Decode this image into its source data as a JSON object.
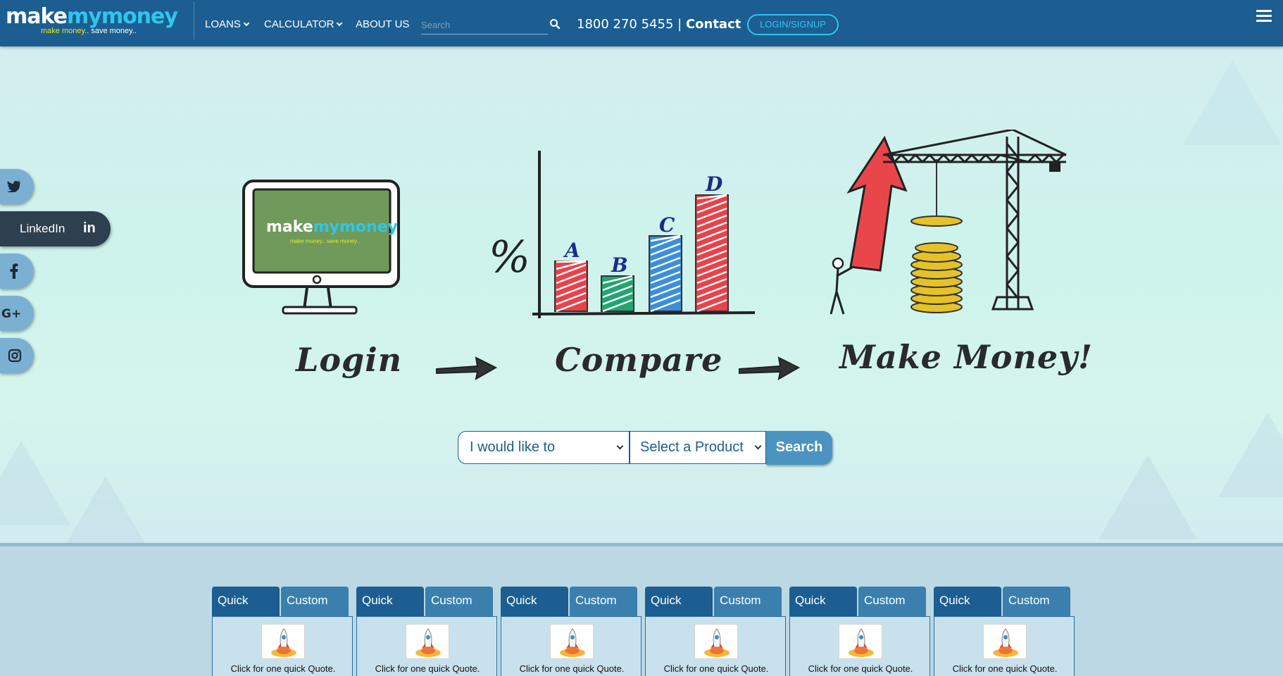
{
  "header": {
    "logo_main_a": "make",
    "logo_main_b": "mymoney",
    "logo_tag_a": "make money..",
    "logo_tag_b": "save money..",
    "nav": [
      "LOANS",
      "CALCULATOR",
      "ABOUT US"
    ],
    "search_placeholder": "Search",
    "phone": "1800 270 5455 |",
    "contact": "Contact",
    "login_label": "LOGIN/SIGNUP"
  },
  "social": {
    "linkedin_label": "LinkedIn",
    "linkedin_glyph": "in"
  },
  "hero": {
    "steps": [
      "Login",
      "Compare",
      "Make Money!"
    ],
    "screen_logo_a": "make",
    "screen_logo_b": "mymoney",
    "screen_tag": "make money.. save money..",
    "bar_letters": [
      "A",
      "B",
      "C",
      "D"
    ],
    "bar_colors": [
      "#e8424b",
      "#22a572",
      "#3b8fd8",
      "#e8424b"
    ],
    "bar_levels": [
      0.43,
      0.3,
      0.65,
      1.0
    ],
    "percent": "%",
    "select_action": "I would like to",
    "select_product": "Select a Product",
    "search_button": "Search"
  },
  "cards": {
    "quick_label": "Quick",
    "custom_label": "Custom",
    "quote_text": "Click for one quick Quote.",
    "count": 6
  },
  "colors": {
    "header_bg": "#1c5e91",
    "accent": "#2fc6ec",
    "logo_yellow": "#e7ea23",
    "button_blue": "#4b94c2"
  }
}
